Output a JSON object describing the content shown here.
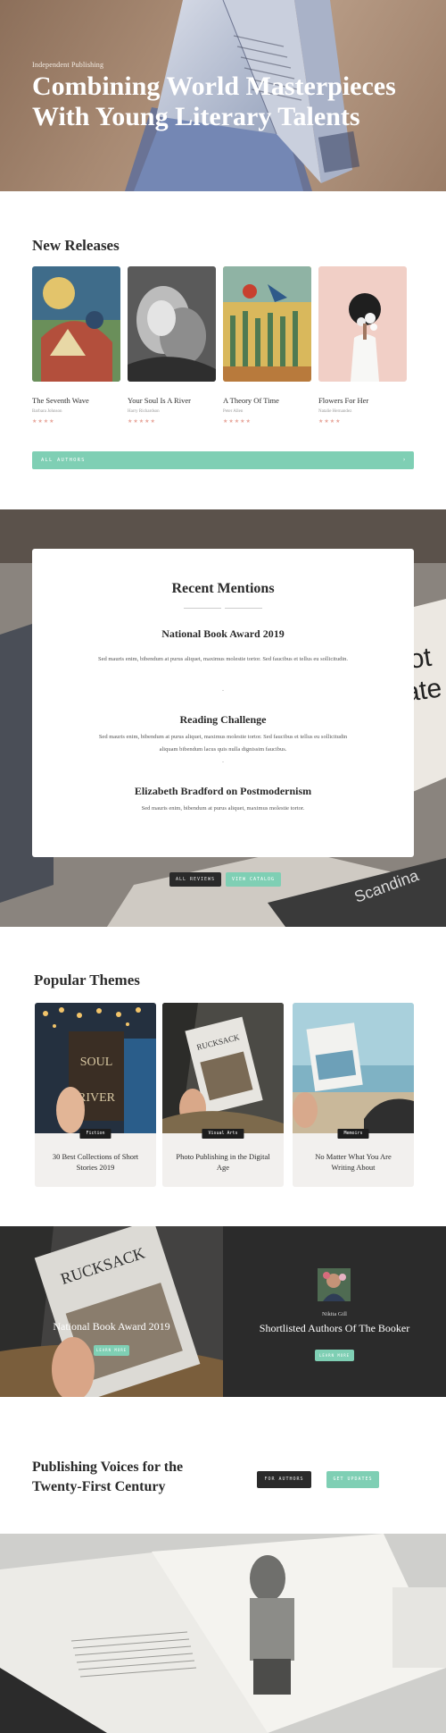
{
  "hero": {
    "eyebrow": "Independent Publishing",
    "title": "Combining World Masterpieces With Young Literary Talents"
  },
  "releases": {
    "title": "New Releases",
    "books": [
      {
        "title": "The Seventh Wave",
        "author": "Barbara Johnson",
        "stars": "★★★★"
      },
      {
        "title": "Your Soul Is A River",
        "author": "Harry Richardson",
        "stars": "★★★★★"
      },
      {
        "title": "A Theory Of Time",
        "author": "Peter Allen",
        "stars": "★★★★★"
      },
      {
        "title": "Flowers For Her",
        "author": "Natalie Hernandez",
        "stars": "★★★★"
      }
    ],
    "authors_button": "ALL AUTHORS",
    "arrow": "›"
  },
  "mentions": {
    "title": "Recent Mentions",
    "items": [
      {
        "title": "National Book Award 2019",
        "text": "Sed mauris enim, bibendum at purus aliquet, maximus molestie tortor. Sed faucibus et tellus eu sollicitudin."
      },
      {
        "title": "Reading Challenge",
        "text": "Sed mauris enim, bibendum at purus aliquet, maximus molestie tortor. Sed faucibus et tellus eu sollicitudin aliquam bibendum lacus quis nulla dignissim faucibus."
      },
      {
        "title": "Elizabeth Bradford on Postmodernism",
        "text": "Sed mauris enim, bibendum at purus aliquet, maximus molestie tortor."
      }
    ],
    "dash": "-",
    "all_reviews": "ALL REVIEWS",
    "view_catalog": "VIEW CATALOG"
  },
  "themes": {
    "title": "Popular Themes",
    "cards": [
      {
        "tag": "Fiction",
        "title": "30 Best Collections of Short Stories 2019",
        "cover_word": "SOUL",
        "cover_word2": "RIVER"
      },
      {
        "tag": "Visual Arts",
        "title": "Photo Publishing in the Digital Age",
        "cover_word": "RUCKSACK"
      },
      {
        "tag": "Memoirs",
        "title": "No Matter What You Are Writing About"
      }
    ]
  },
  "banner": {
    "book_word": "RUCKSACK",
    "award_title": "National Book Award 2019",
    "learn_more": "LEARN MORE",
    "reviewer": "Nikita Gill",
    "shortlist": "Shortlisted Authors Of The Booker",
    "learn_more_2": "LEARN MORE"
  },
  "cta": {
    "title": "Publishing Voices for the Twenty-First Century",
    "for_authors": "FOR AUTHORS",
    "get_updates": "GET UPDATES"
  },
  "colors": {
    "mint": "#7fcfb4",
    "dark": "#2b2b2b",
    "star": "#e7a59a"
  }
}
